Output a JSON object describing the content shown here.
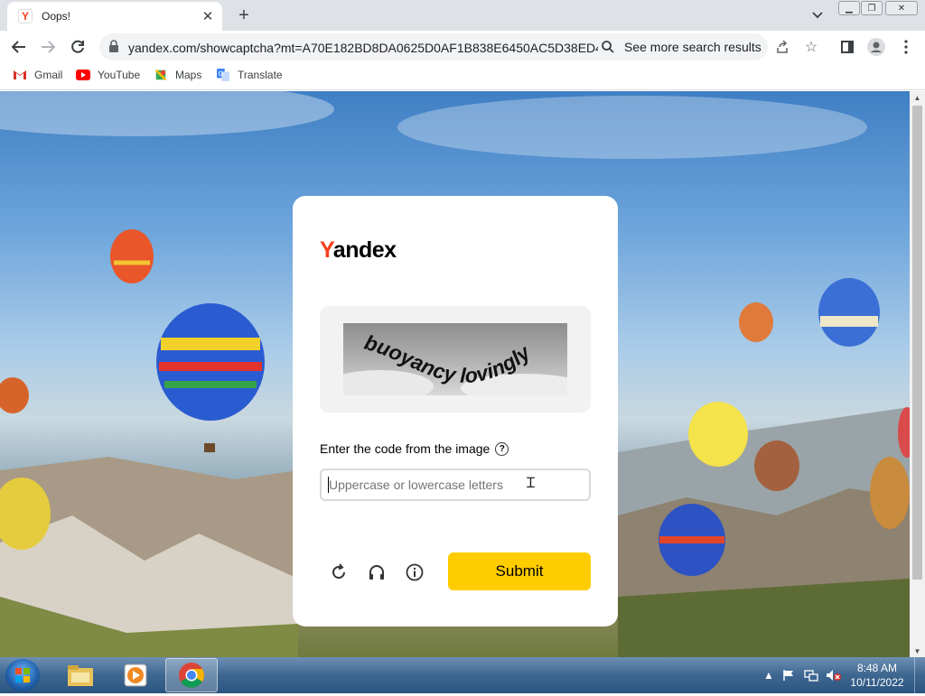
{
  "browser": {
    "tab_title": "Oops!",
    "url": "yandex.com/showcaptcha?mt=A70E182BD8DA0625D0AF1B838E6450AC5D38ED4...",
    "omnibox_hint": "See more search results",
    "tab_favicon_letter": "Y",
    "bookmarks": [
      {
        "label": "Gmail",
        "icon": "gmail-icon"
      },
      {
        "label": "YouTube",
        "icon": "youtube-icon"
      },
      {
        "label": "Maps",
        "icon": "maps-icon"
      },
      {
        "label": "Translate",
        "icon": "translate-icon"
      }
    ]
  },
  "page": {
    "logo_first": "Y",
    "logo_rest": "andex",
    "captcha_text": "buoyancy lovingly",
    "prompt": "Enter the code from the image",
    "help_glyph": "?",
    "input_placeholder": "Uppercase or lowercase letters",
    "input_value": "",
    "submit_label": "Submit",
    "action_icons": [
      "refresh-icon",
      "headphones-icon",
      "info-icon"
    ]
  },
  "taskbar": {
    "time": "8:48 AM",
    "date": "10/11/2022",
    "apps": [
      "explorer-icon",
      "media-player-icon",
      "chrome-icon"
    ]
  },
  "colors": {
    "brand_red": "#fc3f1d",
    "submit_yellow": "#ffcc00"
  }
}
